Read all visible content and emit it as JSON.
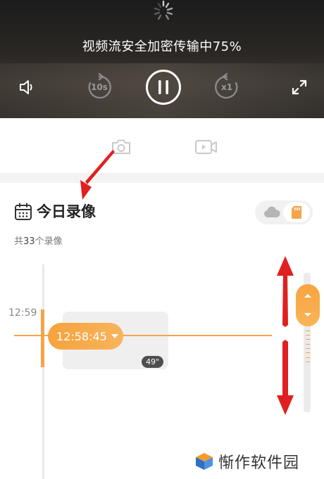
{
  "player": {
    "status_text": "视频流安全加密传输中75%",
    "progress_percent": 75,
    "rewind_label": "10s",
    "speed_label": "x1"
  },
  "records": {
    "title": "今日录像",
    "count_prefix": "共",
    "count_value": "33",
    "count_suffix": "个录像",
    "time_label": "12:59",
    "current_time": "12:58:45",
    "clip_duration": "49\""
  },
  "watermark": {
    "text": "惭作软件园"
  },
  "colors": {
    "accent": "#f5a44a",
    "annotation": "#e02020"
  },
  "icons": {
    "volume": "speaker-icon",
    "rewind": "rewind-10s-icon",
    "pause": "pause-icon",
    "speed": "speed-x1-icon",
    "fullscreen": "fullscreen-icon",
    "snapshot": "camera-icon",
    "record": "video-record-icon",
    "calendar": "calendar-icon",
    "cloud": "cloud-icon",
    "sd_card": "sd-card-icon"
  }
}
